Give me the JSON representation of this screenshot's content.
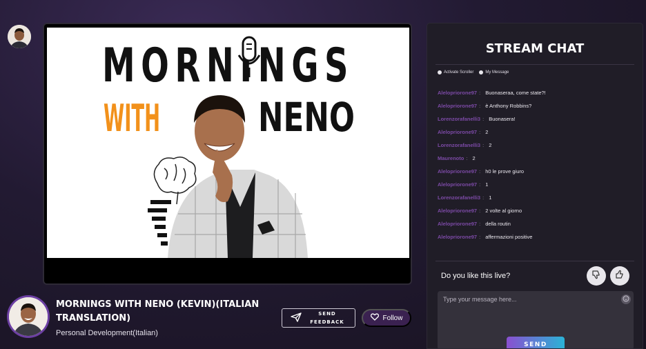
{
  "video": {
    "poster_line1": "MORNINGS",
    "poster_with": "WITH",
    "poster_neno": "NENO",
    "colors": {
      "orange": "#f2911b",
      "black": "#111111"
    }
  },
  "streamer": {
    "title": "MORNINGS WITH NENO (KEVIN)(ITALIAN TRANSLATION)",
    "category": "Personal Development(Italian)"
  },
  "actions": {
    "feedback_label": "SEND FEEDBACK",
    "follow_label": "Follow"
  },
  "chat": {
    "title": "STREAM CHAT",
    "options": [
      "Activate Scroller",
      "My Message"
    ],
    "messages": [
      {
        "user": "Alelopriorone97",
        "text": "Buonaseraa, come state?!"
      },
      {
        "user": "Alelopriorone97",
        "text": "è Anthony Robbins?"
      },
      {
        "user": "Lorenzorafanelli3",
        "text": "Buonasera!"
      },
      {
        "user": "Alelopriorone97",
        "text": "2"
      },
      {
        "user": "Lorenzorafanelli3",
        "text": "2"
      },
      {
        "user": "Maurenoto",
        "text": "2"
      },
      {
        "user": "Alelopriorone97",
        "text": "h0 le prove giuro"
      },
      {
        "user": "Alelopriorone97",
        "text": "1"
      },
      {
        "user": "Lorenzorafanelli3",
        "text": "1"
      },
      {
        "user": "Alelopriorone97",
        "text": "2 volte al giorno"
      },
      {
        "user": "Alelopriorone97",
        "text": "della routin"
      },
      {
        "user": "Alelopriorone97",
        "text": "affermazioni positive"
      }
    ],
    "like_question": "Do you like this live?",
    "input_placeholder": "Type your message here...",
    "send_label": "SEND"
  }
}
